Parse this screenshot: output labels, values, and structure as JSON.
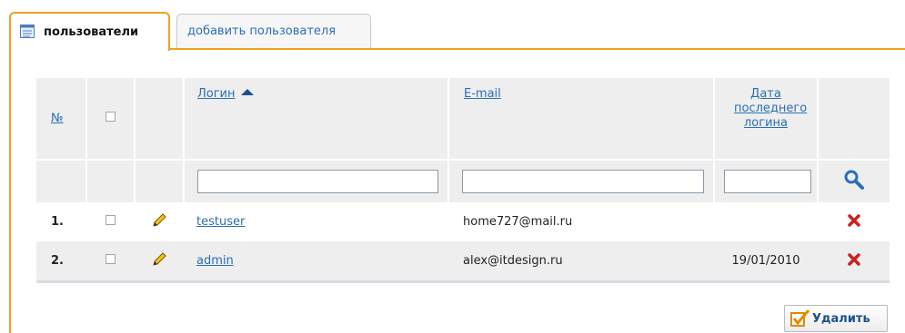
{
  "tabs": [
    {
      "label": "пользователи",
      "active": true,
      "icon": "user-list-icon"
    },
    {
      "label": "добавить пользователя",
      "active": false
    }
  ],
  "table": {
    "headers": {
      "number": "№",
      "login": "Логин",
      "email": "E-mail",
      "last_login": "Дата последнего логина"
    },
    "sort": {
      "column": "login",
      "direction": "ascending"
    },
    "filters": {
      "login": "",
      "email": "",
      "last_login": ""
    },
    "rows": [
      {
        "number": "1.",
        "login": "testuser",
        "email": "home727@mail.ru",
        "last_login": "",
        "checked": false
      },
      {
        "number": "2.",
        "login": "admin",
        "email": "alex@itdesign.ru",
        "last_login": "19/01/2010",
        "checked": false
      }
    ]
  },
  "actions": {
    "delete_label": "Удалить"
  },
  "colors": {
    "accent_orange": "#f0a020",
    "link_blue": "#2a6fb5",
    "delete_red": "#cc1f1f",
    "header_gray": "#eeeeee"
  }
}
